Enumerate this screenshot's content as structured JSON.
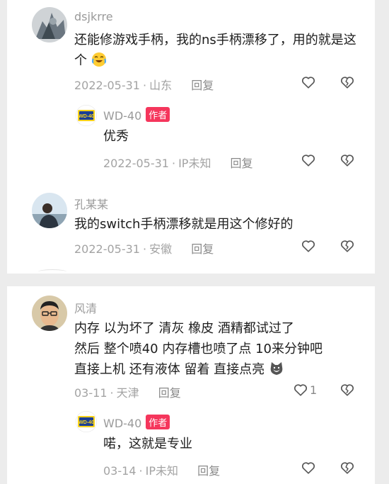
{
  "comments_top": [
    {
      "username": "dsjkrre",
      "text": "还能修游戏手柄，我的ns手柄漂移了，用的就是这个",
      "emoji_icon": "crying-laughing-emoji",
      "date": "2022-05-31",
      "location": "山东",
      "reply_label": "回复",
      "reply": {
        "username": "WD-40",
        "badge": "作者",
        "text": "优秀",
        "date": "2022-05-31",
        "location": "IP未知",
        "reply_label": "回复"
      }
    },
    {
      "username": "孔某某",
      "text": "我的switch手柄漂移就是用这个修好的",
      "date": "2022-05-31",
      "location": "安徽",
      "reply_label": "回复"
    }
  ],
  "comments_bottom": [
    {
      "username": "风清",
      "text_lines": [
        "内存  以为坏了  清灰  橡皮  酒精都试过了",
        "然后 整个喷40  内存槽也喷了点 10来分钟吧",
        "直接上机  还有液体  留着  直接点亮"
      ],
      "emoji_icon": "cat-emoji",
      "date": "03-11",
      "location": "天津",
      "reply_label": "回复",
      "likes": "1",
      "reply": {
        "username": "WD-40",
        "badge": "作者",
        "text": "喏，这就是专业",
        "date": "03-14",
        "location": "IP未知",
        "reply_label": "回复"
      }
    }
  ],
  "separator": "·",
  "icons": {
    "like": "heart-outline-icon",
    "dislike": "broken-heart-icon"
  },
  "colors": {
    "badge": "#f5365c",
    "meta": "#a3a3a3",
    "brand_blue": "#1c3f94",
    "brand_yellow": "#f7d21c"
  }
}
